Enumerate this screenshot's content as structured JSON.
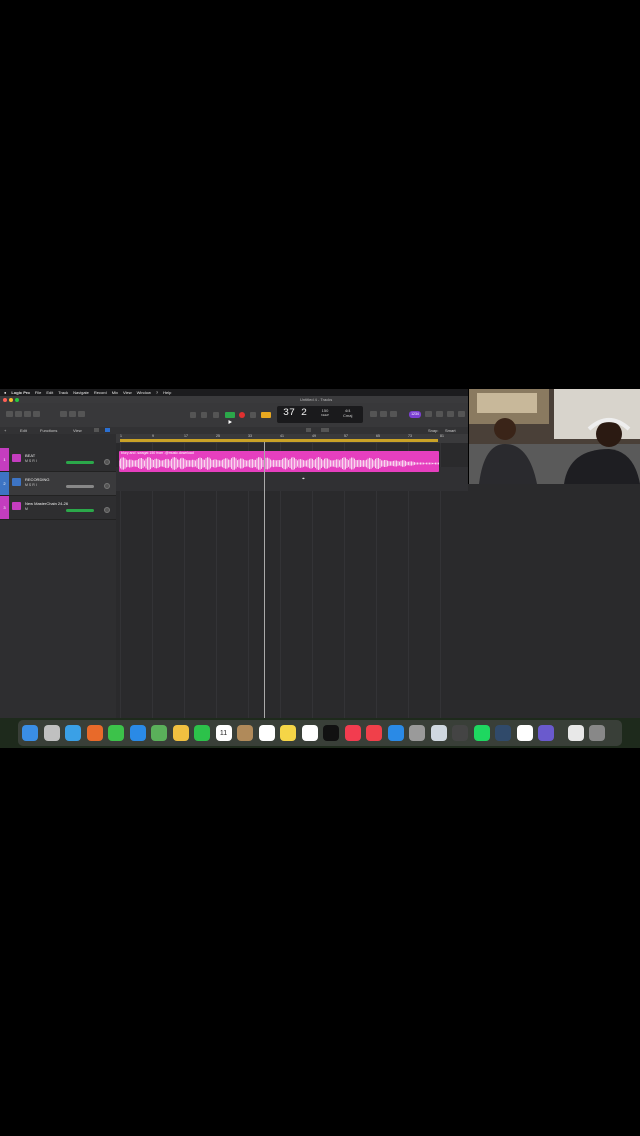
{
  "menubar": {
    "items": [
      "Logic Pro",
      "File",
      "Edit",
      "Track",
      "Navigate",
      "Record",
      "Mix",
      "View",
      "Window",
      "?",
      "Help"
    ]
  },
  "window": {
    "title": "Untitled 4 - Tracks"
  },
  "lcd": {
    "bar": "37",
    "beat": "2",
    "tempo": "150",
    "tempo_label": "KEEP",
    "time_sig": "4/4",
    "key": "Cmaj"
  },
  "badge": "1234",
  "header_toolbar": {
    "edit": "Edit",
    "functions": "Functions",
    "view": "View"
  },
  "arrange_toolbar": {
    "snap": "Snap:",
    "snap_value": "Smart"
  },
  "ruler": {
    "ticks": [
      "1",
      "9",
      "17",
      "25",
      "33",
      "41",
      "49",
      "57",
      "65",
      "73",
      "81"
    ]
  },
  "tracks": [
    {
      "num": "1",
      "name": "BEAT",
      "color": "#c43dbf",
      "controls": "M  S  R  I"
    },
    {
      "num": "2",
      "name": "RECORDING",
      "color": "#3d74c4",
      "controls": "M  S  R  I"
    },
    {
      "num": "3",
      "name": "New MasterChain 24-26",
      "color": "#c43dbf",
      "controls": "M"
    }
  ],
  "region": {
    "label": "blury and .swagat 150 from .@music.download",
    "color": "#e63fbf"
  },
  "colors": {
    "accent_play": "#2ba84a",
    "record": "#e03030",
    "cycle": "#c9a227",
    "region": "#e63fbf"
  },
  "dock": {
    "icons": [
      "finder-icon",
      "launchpad-icon",
      "safari-icon",
      "firefox-icon",
      "messages-icon",
      "mail-icon",
      "maps-icon",
      "photos-icon",
      "facetime-icon",
      "calendar-icon",
      "contacts-icon",
      "reminders-icon",
      "notes-icon",
      "freeform-icon",
      "appletv-icon",
      "music-icon",
      "news-icon",
      "appstore-icon",
      "settings-icon",
      "iphone-mirror-icon",
      "logic-icon",
      "spotify-icon",
      "vpn-icon",
      "chatgpt-icon",
      "imovie-icon",
      "document-icon",
      "trash-icon"
    ],
    "calendar_day": "11"
  }
}
